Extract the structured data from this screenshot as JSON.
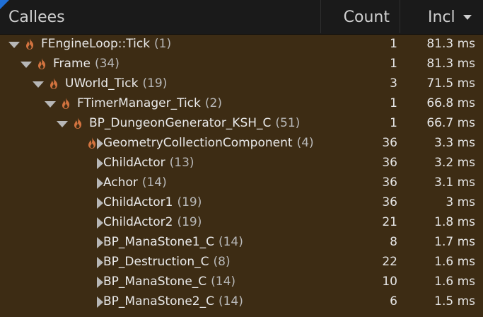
{
  "header": {
    "callees": "Callees",
    "count": "Count",
    "incl": "Incl"
  },
  "rows": [
    {
      "name": "FEngineLoop::Tick",
      "calls": "(1)",
      "count": "1",
      "incl": "81.3 ms",
      "depth": 0,
      "expanded": true,
      "hot": true
    },
    {
      "name": "Frame",
      "calls": "(34)",
      "count": "1",
      "incl": "81.3 ms",
      "depth": 1,
      "expanded": true,
      "hot": true
    },
    {
      "name": "UWorld_Tick",
      "calls": "(19)",
      "count": "3",
      "incl": "71.5 ms",
      "depth": 2,
      "expanded": true,
      "hot": true
    },
    {
      "name": "FTimerManager_Tick",
      "calls": "(2)",
      "count": "1",
      "incl": "66.8 ms",
      "depth": 3,
      "expanded": true,
      "hot": true
    },
    {
      "name": "BP_DungeonGenerator_KSH_C",
      "calls": "(51)",
      "count": "1",
      "incl": "66.7 ms",
      "depth": 4,
      "expanded": true,
      "hot": true
    },
    {
      "name": "GeometryCollectionComponent",
      "calls": "(4)",
      "count": "36",
      "incl": "3.3 ms",
      "depth": 5,
      "expanded": false,
      "hot": true
    },
    {
      "name": "ChildActor",
      "calls": "(13)",
      "count": "36",
      "incl": "3.2 ms",
      "depth": 5,
      "expanded": false,
      "hot": false
    },
    {
      "name": "Achor",
      "calls": "(14)",
      "count": "36",
      "incl": "3.1 ms",
      "depth": 5,
      "expanded": false,
      "hot": false
    },
    {
      "name": "ChildActor1",
      "calls": "(19)",
      "count": "36",
      "incl": "3 ms",
      "depth": 5,
      "expanded": false,
      "hot": false
    },
    {
      "name": "ChildActor2",
      "calls": "(19)",
      "count": "21",
      "incl": "1.8 ms",
      "depth": 5,
      "expanded": false,
      "hot": false
    },
    {
      "name": "BP_ManaStone1_C",
      "calls": "(14)",
      "count": "8",
      "incl": "1.7 ms",
      "depth": 5,
      "expanded": false,
      "hot": false
    },
    {
      "name": "BP_Destruction_C",
      "calls": "(8)",
      "count": "22",
      "incl": "1.6 ms",
      "depth": 5,
      "expanded": false,
      "hot": false
    },
    {
      "name": "BP_ManaStone_C",
      "calls": "(14)",
      "count": "10",
      "incl": "1.6 ms",
      "depth": 5,
      "expanded": false,
      "hot": false
    },
    {
      "name": "BP_ManaStone2_C",
      "calls": "(14)",
      "count": "6",
      "incl": "1.5 ms",
      "depth": 5,
      "expanded": false,
      "hot": false
    }
  ]
}
